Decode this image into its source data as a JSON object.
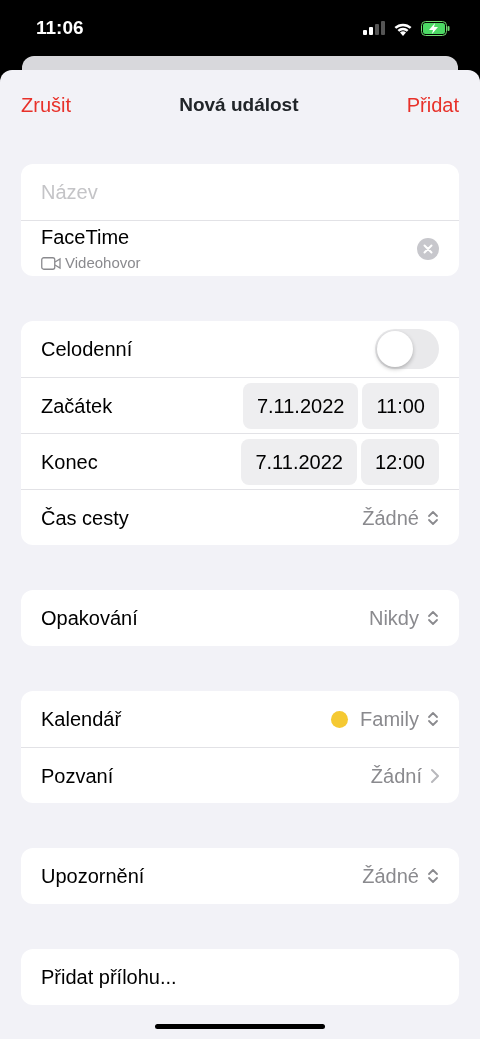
{
  "status_bar": {
    "time": "11:06"
  },
  "nav": {
    "cancel": "Zrušit",
    "title": "Nová událost",
    "add": "Přidat"
  },
  "groups": [
    {
      "rows": [
        {
          "kind": "field",
          "placeholder": "Název"
        },
        {
          "kind": "location",
          "title": "FaceTime",
          "subtitle": "Videohovor"
        }
      ]
    },
    {
      "rows": [
        {
          "kind": "toggle",
          "label": "Celodenní",
          "on": false
        },
        {
          "kind": "datetime",
          "label": "Začátek",
          "date": "7.11.2022",
          "time": "11:00"
        },
        {
          "kind": "datetime",
          "label": "Konec",
          "date": "7.11.2022",
          "time": "12:00"
        },
        {
          "kind": "popup",
          "label": "Čas cesty",
          "value": "Žádné"
        }
      ]
    },
    {
      "rows": [
        {
          "kind": "popup",
          "label": "Opakování",
          "value": "Nikdy"
        }
      ]
    },
    {
      "rows": [
        {
          "kind": "popup",
          "label": "Kalendář",
          "value": "Family",
          "color": "#f5c932"
        },
        {
          "kind": "link",
          "label": "Pozvaní",
          "value": "Žádní"
        }
      ]
    },
    {
      "rows": [
        {
          "kind": "popup",
          "label": "Upozornění",
          "value": "Žádné"
        }
      ]
    },
    {
      "rows": [
        {
          "kind": "action",
          "label": "Přidat přílohu..."
        }
      ]
    }
  ]
}
